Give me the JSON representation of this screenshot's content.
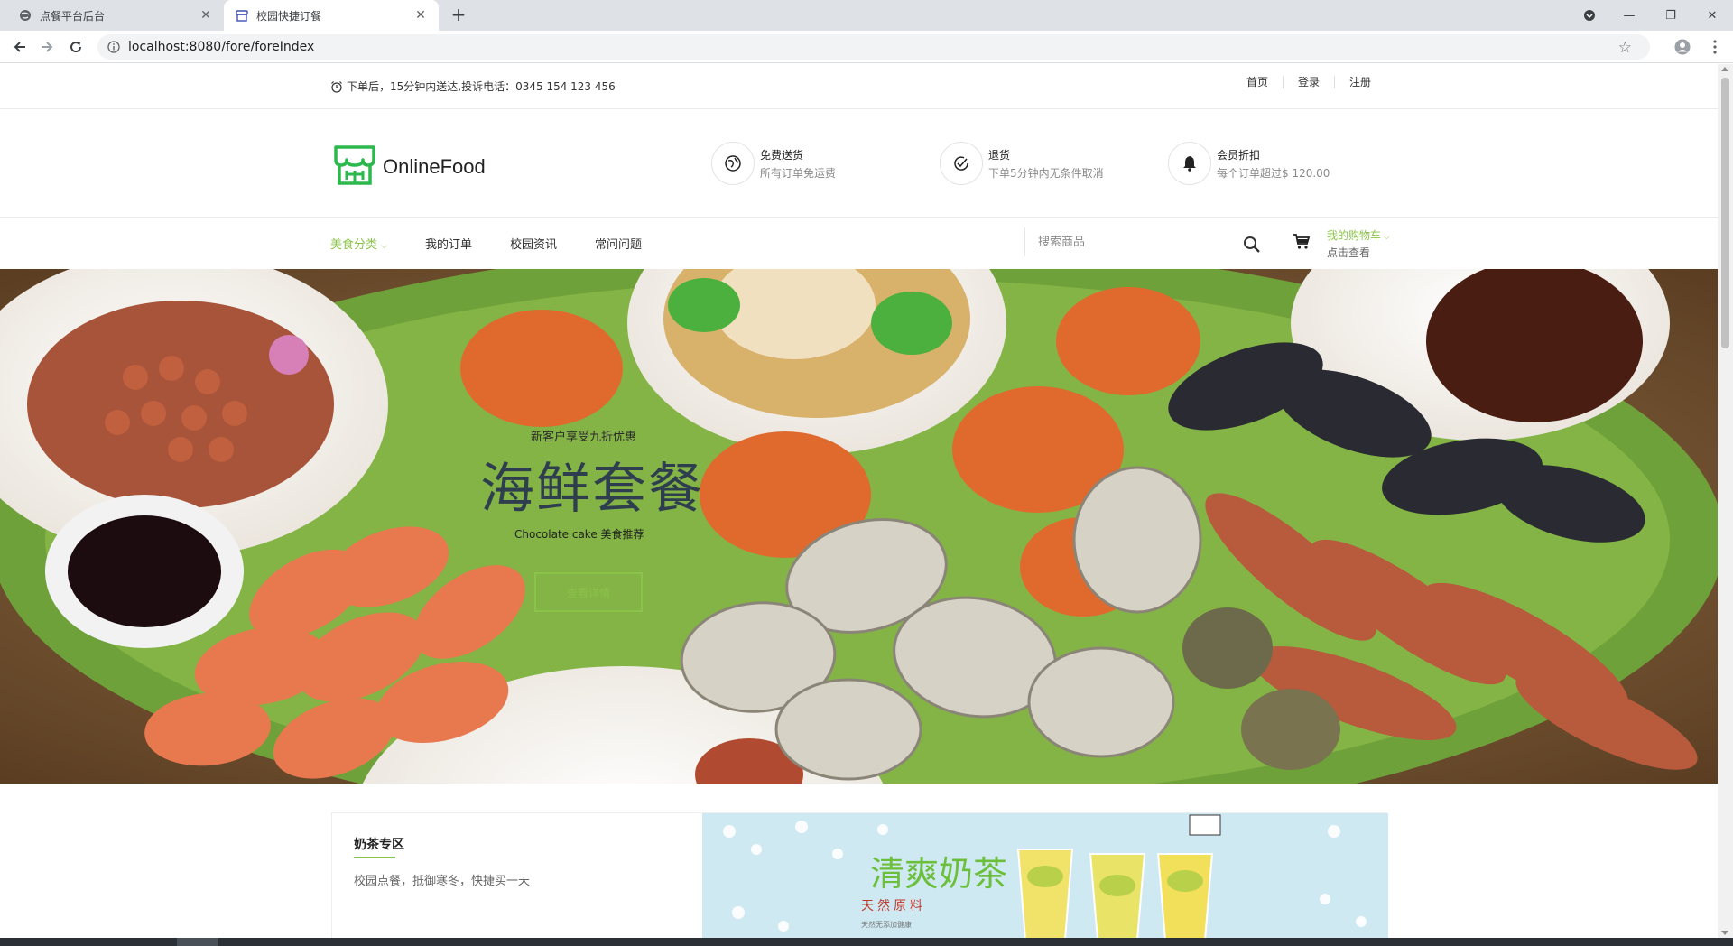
{
  "browser": {
    "tabs": [
      {
        "title": "点餐平台后台",
        "active": false
      },
      {
        "title": "校园快捷订餐",
        "active": true
      }
    ],
    "url": "localhost:8080/fore/foreIndex"
  },
  "topbar": {
    "notice": "下单后，15分钟内送达,投诉电话：0345 154 123 456",
    "links": [
      "首页",
      "登录",
      "注册"
    ]
  },
  "header": {
    "brand": "OnlineFood",
    "features": [
      {
        "icon": "globe-icon",
        "title": "免费送货",
        "subtitle": "所有订单免运费"
      },
      {
        "icon": "check-circle-icon",
        "title": "退货",
        "subtitle": "下单5分钟内无条件取消"
      },
      {
        "icon": "bell-icon",
        "title": "会员折扣",
        "subtitle": "每个订单超过$ 120.00"
      }
    ]
  },
  "nav": {
    "items": [
      "美食分类",
      "我的订单",
      "校园资讯",
      "常问问题"
    ],
    "search_placeholder": "搜索商品",
    "cart_label": "我的购物车",
    "cart_sub": "点击查看"
  },
  "hero": {
    "subtitle": "新客户享受九折优惠",
    "title": "海鲜套餐",
    "desc": "Chocolate cake 美食推荐",
    "button": "查看详情"
  },
  "milk_tea": {
    "title": "奶茶专区",
    "desc": "校园点餐，抵御寒冬，快捷买一天",
    "banner_title": "清爽奶茶",
    "banner_sub": "天然原料",
    "banner_small": "天然无添加健康"
  },
  "colors": {
    "accent": "#8bc34a",
    "hero_title": "#2f3e4e"
  }
}
